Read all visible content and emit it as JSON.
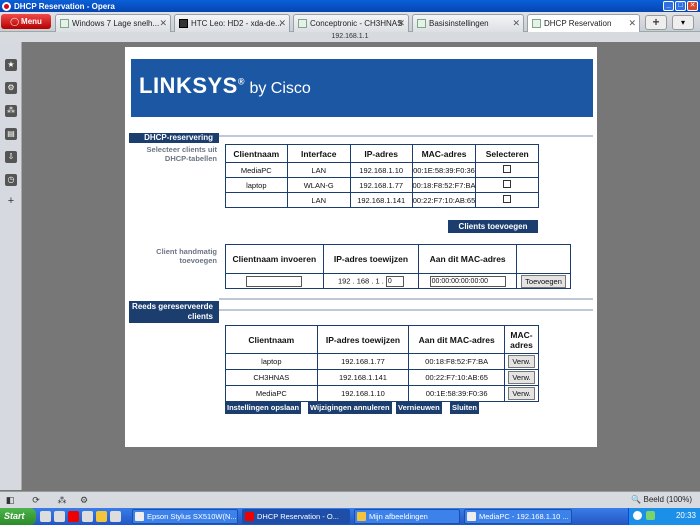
{
  "window": {
    "title": "DHCP Reservation - Opera"
  },
  "browser": {
    "menu_label": "Menu",
    "tabs": [
      {
        "label": "Windows 7 Lage snelh..."
      },
      {
        "label": "HTC Leo: HD2 - xda-de..."
      },
      {
        "label": "Conceptronic - CH3HNAS"
      },
      {
        "label": "Basisinstellingen"
      },
      {
        "label": "DHCP Reservation"
      }
    ],
    "address": "192.168.1.1"
  },
  "page": {
    "brand_main": "LINKSYS",
    "brand_reg": "®",
    "brand_by": " by Cisco",
    "section_dhcp": "DHCP-reservering",
    "label_select_clients": "Selecteer clients uit DHCP-tabellen",
    "dhcp_table": {
      "headers": [
        "Clientnaam",
        "Interface",
        "IP-adres",
        "MAC-adres",
        "Selecteren"
      ],
      "rows": [
        {
          "name": "MediaPC",
          "iface": "LAN",
          "ip": "192.168.1.10",
          "mac": "00:1E:58:39:F0:36"
        },
        {
          "name": "laptop",
          "iface": "WLAN-G",
          "ip": "192.168.1.77",
          "mac": "00:18:F8:52:F7:BA"
        },
        {
          "name": "",
          "iface": "LAN",
          "ip": "192.168.1.141",
          "mac": "00:22:F7:10:AB:65"
        }
      ]
    },
    "add_clients_button": "Clients toevoegen",
    "label_manual": "Client handmatig toevoegen",
    "manual_table": {
      "headers": [
        "Clientnaam invoeren",
        "IP-adres toewijzen",
        "Aan dit MAC-adres"
      ],
      "ip_prefix": "192 . 168 . 1 .",
      "ip_last": "0",
      "mac_value": "00:00:00:00:00:00",
      "add_button": "Toevoegen"
    },
    "section_reserved": "Reeds gereserveerde clients",
    "reserved_table": {
      "headers": [
        "Clientnaam",
        "IP-adres toewijzen",
        "Aan dit MAC-adres",
        "MAC-adres"
      ],
      "rows": [
        {
          "name": "laptop",
          "ip": "192.168.1.77",
          "mac": "00:18:F8:52:F7:BA",
          "action": "Verw."
        },
        {
          "name": "CH3HNAS",
          "ip": "192.168.1.141",
          "mac": "00:22:F7:10:AB:65",
          "action": "Verw."
        },
        {
          "name": "MediaPC",
          "ip": "192.168.1.10",
          "mac": "00:1E:58:39:F0:36",
          "action": "Verw."
        }
      ]
    },
    "footer_buttons": {
      "save": "Instellingen opslaan",
      "cancel": "Wijzigingen annuleren",
      "refresh": "Vernieuwen",
      "close": "Sluiten"
    }
  },
  "statusbar": {
    "zoom": "Beeld (100%)"
  },
  "taskbar": {
    "start": "Start",
    "tasks": [
      {
        "label": "Epson Stylus SX510W(N..."
      },
      {
        "label": "DHCP Reservation - O..."
      },
      {
        "label": "Mijn afbeeldingen"
      },
      {
        "label": "MediaPC - 192.168.1.10 ..."
      }
    ],
    "clock": "20:33"
  },
  "colors": {
    "brand_blue": "#1b57a3",
    "section_navy": "#1b3e6e"
  }
}
